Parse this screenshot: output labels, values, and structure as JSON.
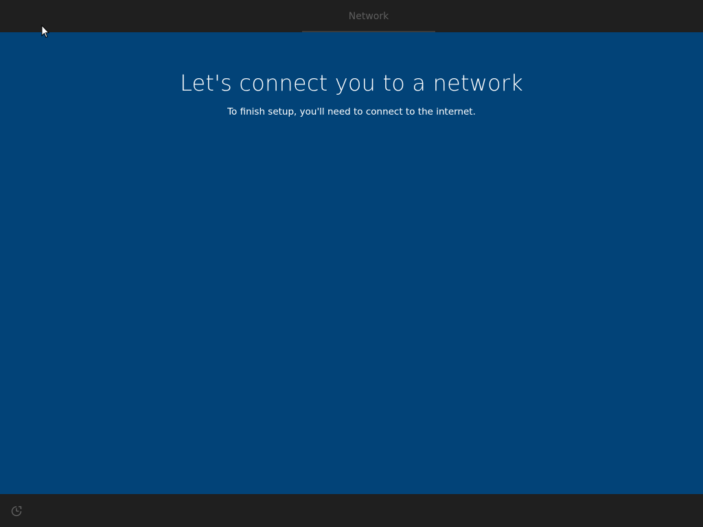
{
  "header": {
    "active_step": "Network"
  },
  "main": {
    "title": "Let's connect you to a network",
    "subtitle": "To finish setup, you'll need to connect to the internet."
  },
  "footer": {
    "ease_of_access_icon": "ease-of-access-icon"
  },
  "colors": {
    "background": "#024378",
    "bars": "#1f1f1f",
    "tab_text": "#5e5e5e",
    "text": "#ffffff"
  }
}
